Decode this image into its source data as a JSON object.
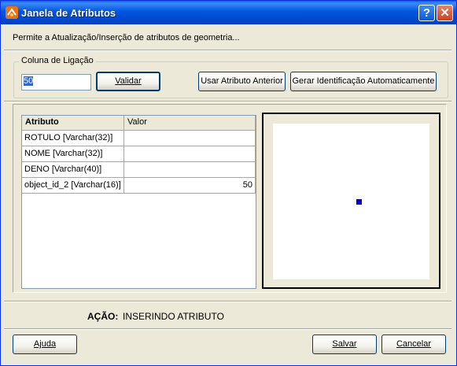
{
  "window": {
    "title": "Janela de Atributos",
    "help_button": "?",
    "close_button": "✕"
  },
  "description": "Permite a Atualização/Inserção de atributos de geometria...",
  "link_column": {
    "group_label": "Coluna de Ligação",
    "input_value": "50",
    "validate_button": "Validar",
    "use_previous_button": "Usar Atributo Anterior",
    "auto_id_button": "Gerar Identificação Automaticamente"
  },
  "attributes_table": {
    "headers": [
      "Atributo",
      "Valor"
    ],
    "rows": [
      {
        "attribute": "ROTULO [Varchar(32)]",
        "value": ""
      },
      {
        "attribute": "NOME [Varchar(32)]",
        "value": ""
      },
      {
        "attribute": "DENO [Varchar(40)]",
        "value": ""
      },
      {
        "attribute": "object_id_2 [Varchar(16)]",
        "value": "50"
      }
    ]
  },
  "status": {
    "label": "AÇÃO:",
    "value": "INSERINDO ATRIBUTO"
  },
  "footer": {
    "help_button": "Ajuda",
    "save_button": "Salvar",
    "cancel_button": "Cancelar"
  },
  "colors": {
    "titlebar": "#0054E3",
    "window_bg": "#ECE9D8",
    "point": "#0000E0"
  }
}
